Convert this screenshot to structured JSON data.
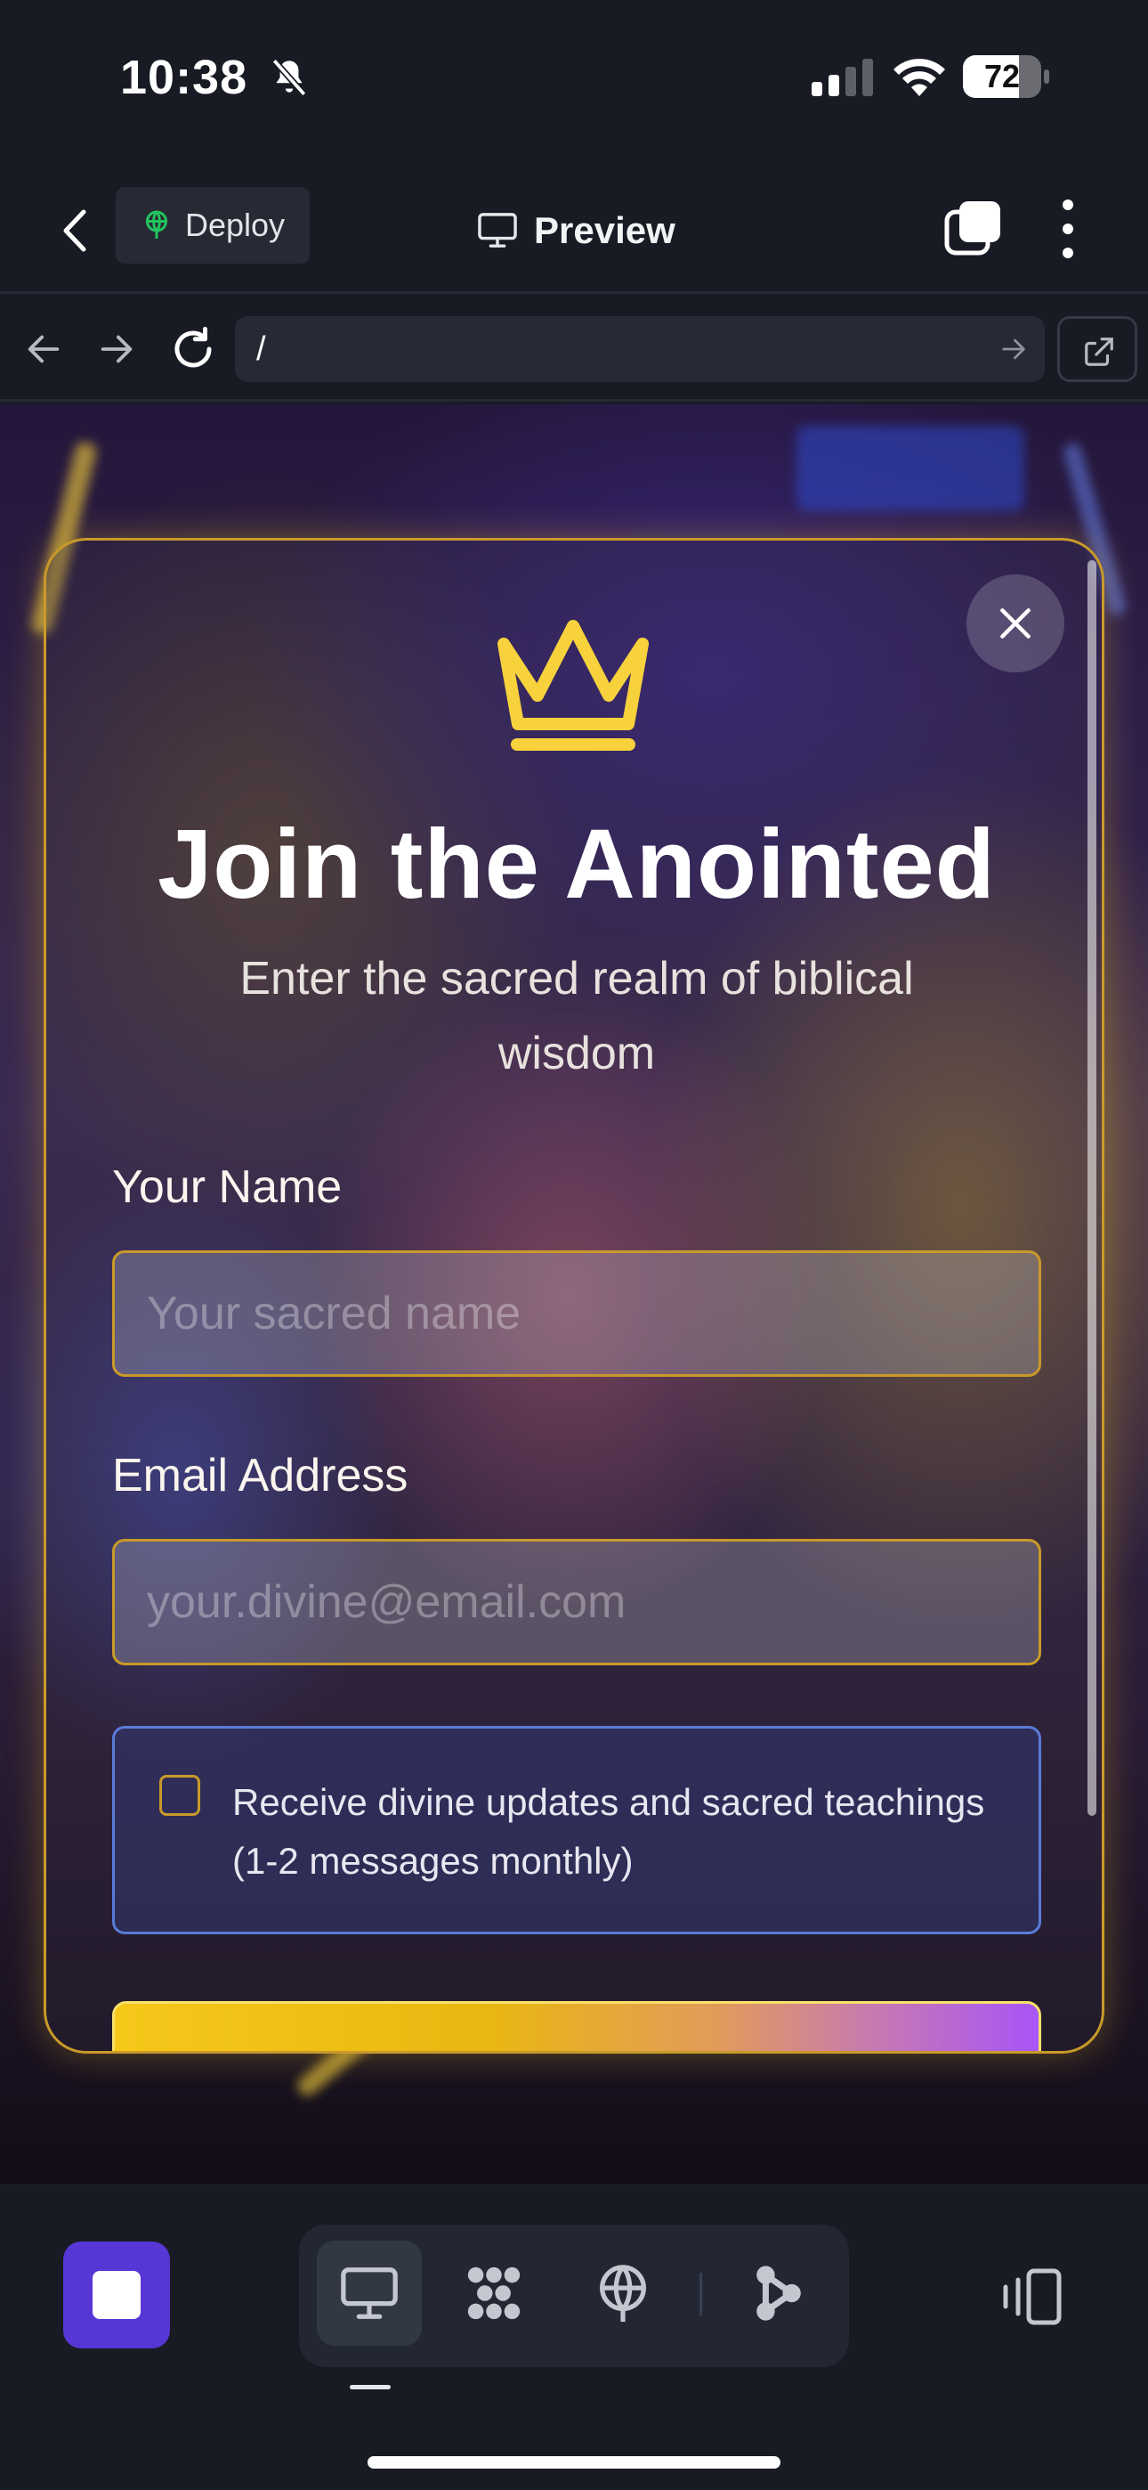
{
  "status_bar": {
    "time": "10:38",
    "battery_percent": 72,
    "battery_label": "72",
    "icons": [
      "bell-slash-icon",
      "cellular-signal-icon",
      "wifi-icon",
      "battery-icon"
    ]
  },
  "app_toolbar": {
    "deploy_label": "Deploy",
    "preview_label": "Preview",
    "icons": [
      "back-chevron-icon",
      "globe-sprout-icon",
      "monitor-icon",
      "tabs-icon",
      "more-vertical-icon"
    ]
  },
  "browser_bar": {
    "url": "/",
    "icons": [
      "arrow-left-icon",
      "arrow-right-icon",
      "reload-icon",
      "go-arrow-icon",
      "external-link-icon"
    ]
  },
  "modal": {
    "title": "Join the Anointed",
    "subtitle": "Enter the sacred realm of biblical wisdom",
    "name_label": "Your Name",
    "name_placeholder": "Your sacred name",
    "name_value": "",
    "email_label": "Email Address",
    "email_placeholder": "your.divine@email.com",
    "email_value": "",
    "consent_text": "Receive divine updates and sacred teachings (1-2 messages monthly)",
    "consent_checked": false,
    "icons": [
      "crown-icon",
      "close-icon"
    ],
    "colors": {
      "accent_gold": "#f7d23c",
      "border_gold": "#c99a2a",
      "consent_border": "#5b7bd8",
      "submit_gradient_end": "#a855f7"
    }
  },
  "bottom_bar": {
    "icons": [
      "stop-icon",
      "desktop-icon",
      "grid-apps-icon",
      "deploy-globe-icon",
      "share-nodes-icon",
      "layout-toggle-icon"
    ],
    "active_tool": "desktop-icon",
    "accent": "#5637d6"
  }
}
